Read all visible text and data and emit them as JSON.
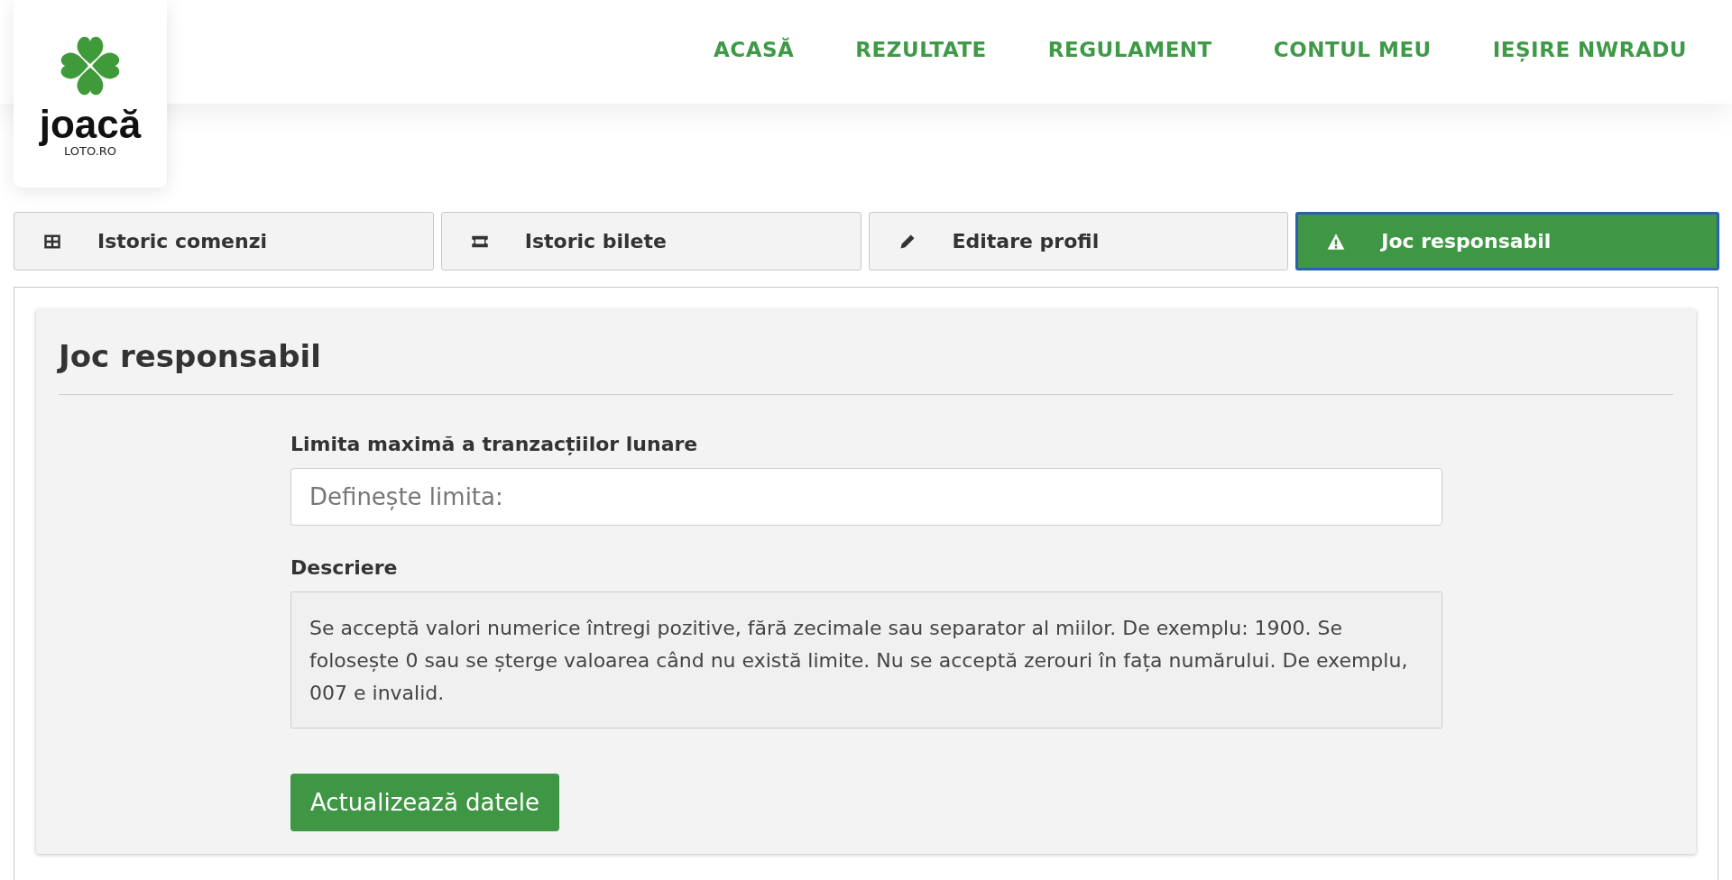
{
  "logo": {
    "wordmark": "joacă",
    "domain": "LOTO.RO"
  },
  "nav": [
    {
      "label": "ACASĂ"
    },
    {
      "label": "REZULTATE"
    },
    {
      "label": "REGULAMENT"
    },
    {
      "label": "CONTUL MEU"
    },
    {
      "label": "IEȘIRE NWRADU"
    }
  ],
  "tabs": [
    {
      "label": "Istoric comenzi",
      "kind": "orders",
      "selected": false
    },
    {
      "label": "Istoric bilete",
      "kind": "tickets",
      "selected": false
    },
    {
      "label": "Editare profil",
      "kind": "profile",
      "selected": false
    },
    {
      "label": "Joc responsabil",
      "kind": "responsible",
      "selected": true
    }
  ],
  "panel": {
    "title": "Joc responsabil",
    "limit_label": "Limita maximă a tranzacțiilor lunare",
    "limit_placeholder": "Definește limita:",
    "description_label": "Descriere",
    "description": "Se acceptă valori numerice întregi pozitive, fără zecimale sau separator al miilor. De exemplu: 1900. Se folosește 0 sau se șterge valoarea când nu există limite. Nu se acceptă zerouri în fața numărului. De exemplu, 007 e invalid.",
    "submit": "Actualizează datele"
  }
}
